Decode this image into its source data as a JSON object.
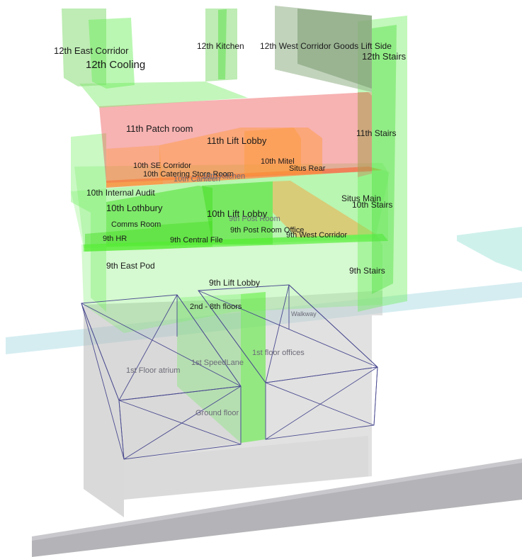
{
  "labels": {
    "east_corridor_12": "12th East Corridor",
    "cooling_12": "12th Cooling",
    "kitchen_12": "12th Kitchen",
    "west_corridor_12": "12th West Corridor Goods Lift Side",
    "stairs_12": "12th Stairs",
    "patch_room_11": "11th Patch room",
    "lift_lobby_11": "11th Lift Lobby",
    "stairs_11": "11th Stairs",
    "se_corridor_10": "10th SE Corridor",
    "catering_store_10": "10th Catering Store Room",
    "canteen_10": "10th Canteen",
    "kitchen_10": "10th Kitchen",
    "mitel_10": "10th Mitel",
    "situs_rear": "Situs Rear",
    "internal_audit_10": "10th Internal Audit",
    "situs_main": "Situs Main",
    "stairs_10": "10th Stairs",
    "lothbury_10": "10th Lothbury",
    "lift_lobby_10": "10th Lift Lobby",
    "post_room_9": "9th Post Room",
    "comms_room": "Comms Room",
    "post_room_office_9": "9th Post Room Office",
    "hr_9": "9th HR",
    "central_file_9": "9th Central File",
    "west_corridor_9": "9th West Corridor",
    "east_pod_9": "9th East Pod",
    "stairs_9": "9th Stairs",
    "lift_lobby_9": "9th Lift Lobby",
    "floors_2_8": "2nd - 8th floors",
    "walkway": "Walkway",
    "atrium_1": "1st Floor atrium",
    "speedlane_1": "1st SpeedLane",
    "offices_1": "1st floor offices",
    "ground_floor": "Ground floor"
  },
  "colors": {
    "volume_green": "#66ee55",
    "volume_red": "#ee5555",
    "volume_orange": "#ff9933",
    "building_gray": "#bfbfbf",
    "street_gray": "#b4b4b8",
    "walkway_cyan": "#bfe8ea",
    "wireframe_blue": "#4a4a90"
  }
}
